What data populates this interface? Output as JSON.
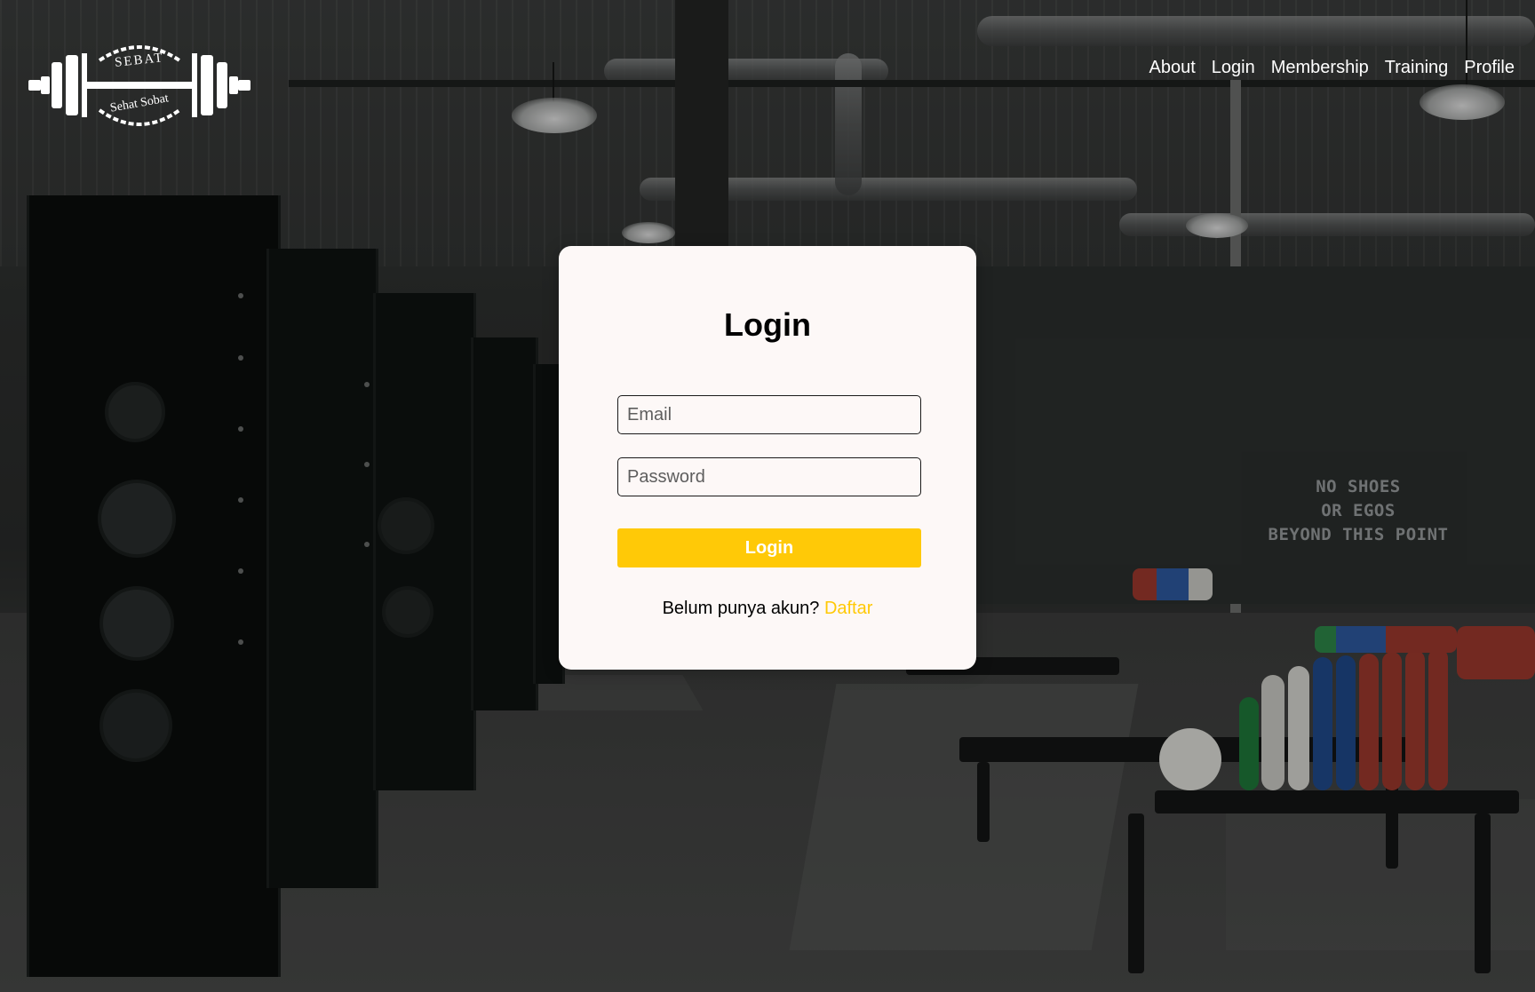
{
  "brand": {
    "logo_icon": "barbell-laurel-logo",
    "logo_top_text": "SEBAT",
    "logo_bottom_text": "Sehat Sobat"
  },
  "nav": {
    "items": [
      {
        "label": "About"
      },
      {
        "label": "Login"
      },
      {
        "label": "Membership"
      },
      {
        "label": "Training"
      },
      {
        "label": "Profile"
      }
    ]
  },
  "background": {
    "wall_text_lines": [
      "NO SHOES",
      "OR EGOS",
      "BEYOND THIS POINT"
    ]
  },
  "login_card": {
    "title": "Login",
    "email_placeholder": "Email",
    "email_value": "",
    "password_placeholder": "Password",
    "password_value": "",
    "submit_label": "Login",
    "register_prompt": "Belum punya akun?",
    "register_link": "Daftar"
  },
  "colors": {
    "accent": "#ffc907",
    "card_background": "#fdf8f7",
    "nav_text": "#ffffff"
  }
}
